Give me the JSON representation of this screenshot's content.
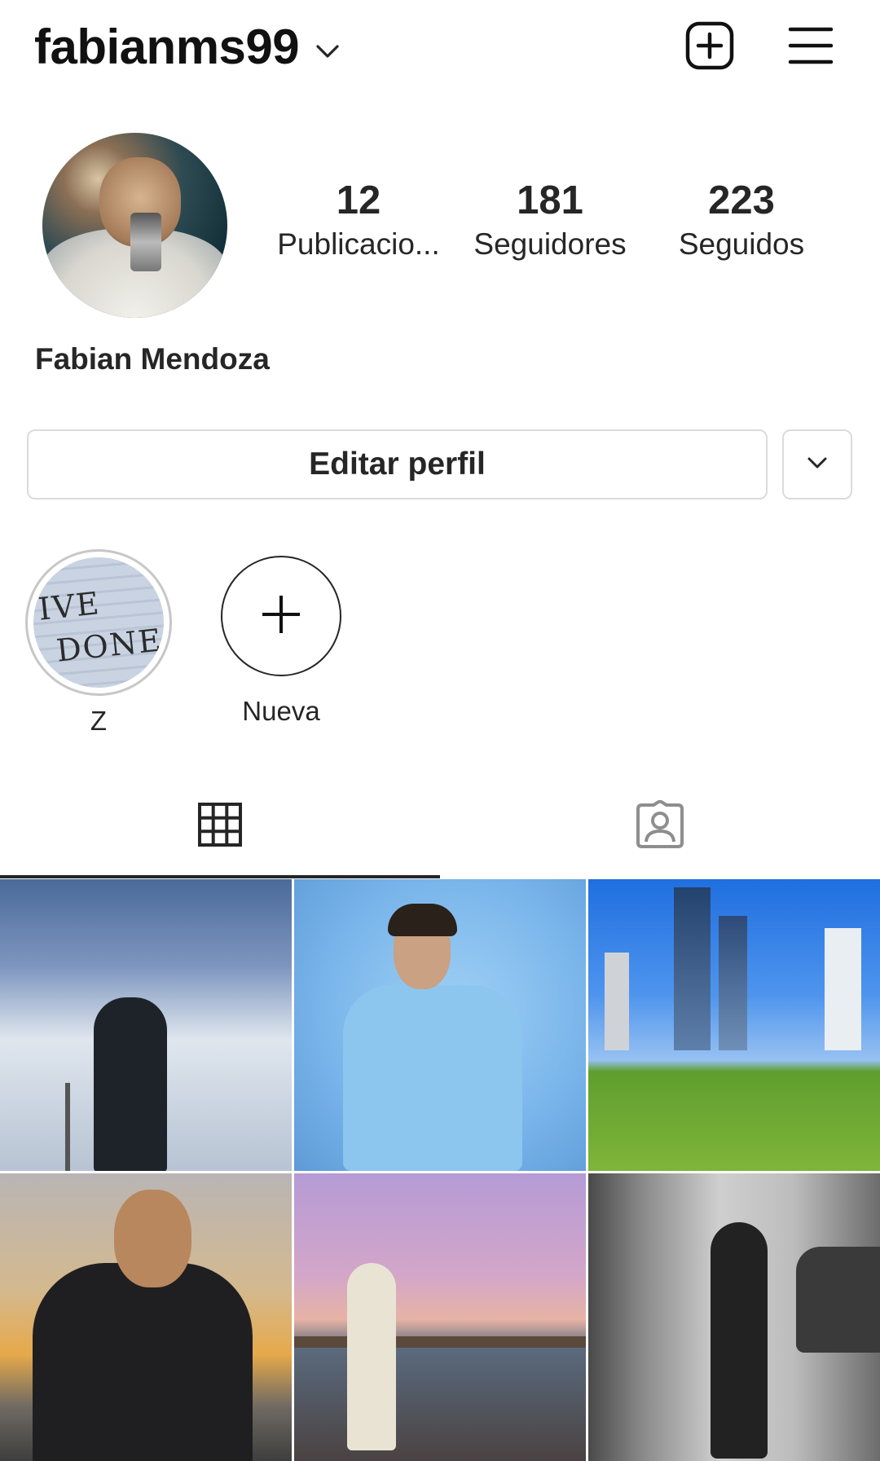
{
  "header": {
    "username": "fabianms99",
    "icons": {
      "dropdown": "chevron-down-icon",
      "add": "add-post-icon",
      "menu": "hamburger-menu-icon"
    }
  },
  "profile": {
    "name": "Fabian Mendoza",
    "stats": [
      {
        "number": "12",
        "label": "Publicacio..."
      },
      {
        "number": "181",
        "label": "Seguidores"
      },
      {
        "number": "223",
        "label": "Seguidos"
      }
    ]
  },
  "actions": {
    "edit_profile": "Editar perfil",
    "more_icon": "chevron-down-icon"
  },
  "highlights": [
    {
      "label": "Z",
      "type": "story"
    },
    {
      "label": "Nueva",
      "type": "new"
    }
  ],
  "tabs": [
    {
      "icon": "grid-icon",
      "active": true
    },
    {
      "icon": "tagged-icon",
      "active": false
    }
  ],
  "grid": {
    "post_count_visible": 6
  },
  "colors": {
    "text": "#262626",
    "border": "#dbdbdb",
    "background": "#ffffff"
  }
}
